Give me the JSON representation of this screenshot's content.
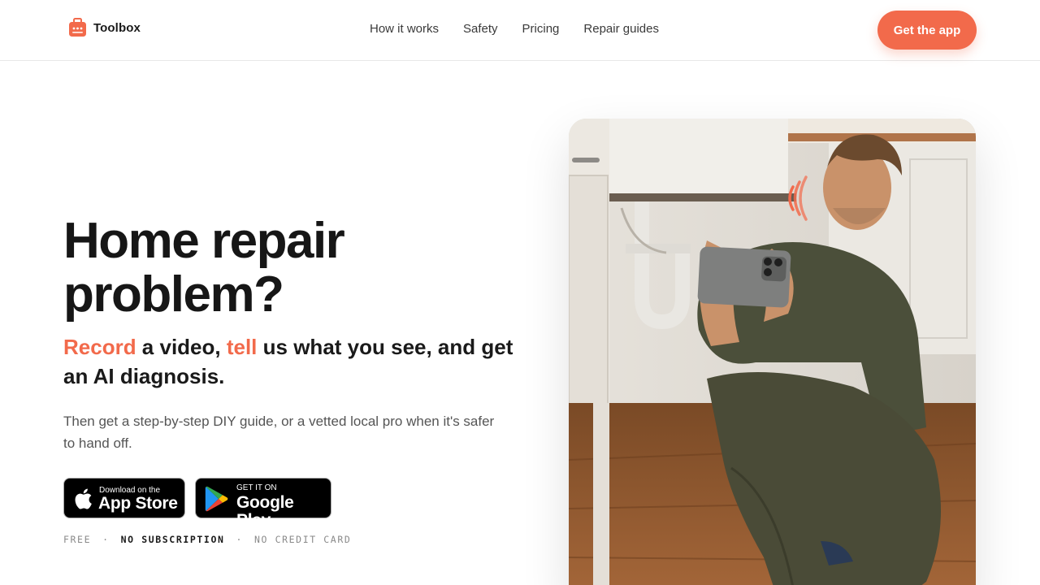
{
  "brand": {
    "name": "Toolbox",
    "accent_color": "#f26a4b",
    "logo_icon": "toolbox-icon"
  },
  "nav": {
    "items": [
      {
        "label": "How it works"
      },
      {
        "label": "Safety"
      },
      {
        "label": "Pricing"
      },
      {
        "label": "Repair guides"
      }
    ],
    "cta_label": "Get the app"
  },
  "hero": {
    "title": "Home repair problem?",
    "subtitle": {
      "accent_1": "Record",
      "text_1": " a video, ",
      "accent_2": "tell",
      "text_2": " us what you see, and get an AI diagnosis."
    },
    "description": "Then get a step-by-step DIY guide, or a vetted local pro when it's safer to hand off.",
    "badges": {
      "apple": {
        "small": "Download on the",
        "big": "App Store",
        "icon": "apple-icon"
      },
      "google": {
        "small": "GET IT ON",
        "big": "Google Play",
        "icon": "google-play-icon"
      }
    },
    "meta": {
      "item_1": "FREE",
      "sep": "·",
      "item_2": "NO SUBSCRIPTION",
      "item_3": "NO CREDIT CARD"
    },
    "image_icon": "sound-waves-icon"
  }
}
